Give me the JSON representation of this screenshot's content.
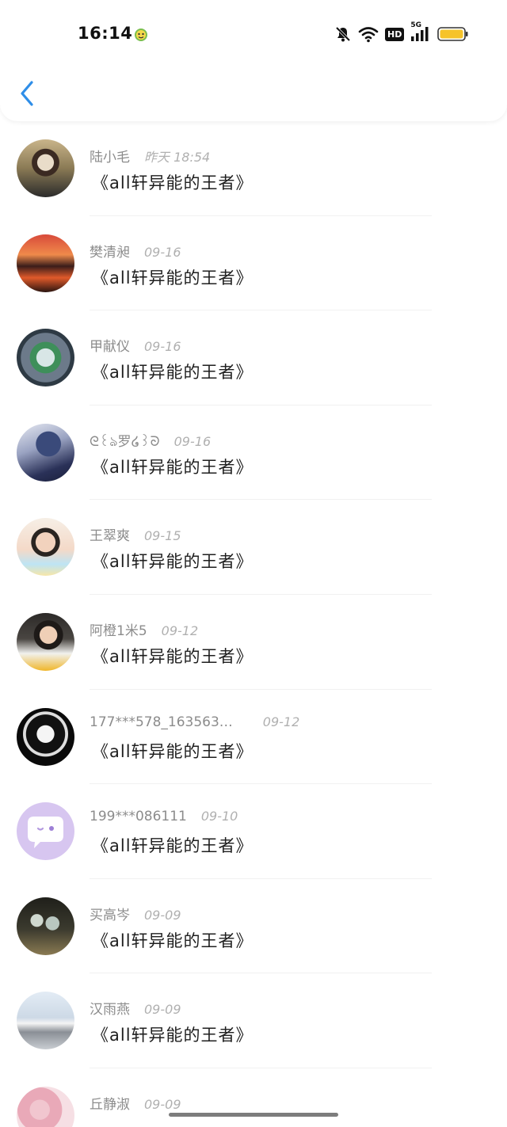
{
  "status_bar": {
    "time": "16:14",
    "network": "5G",
    "hd": "HD",
    "battery_color": "#f6c32a"
  },
  "header": {
    "back_icon": "chevron-left-icon",
    "accent": "#2f8ee8"
  },
  "items": [
    {
      "name": "陆小毛",
      "date": "昨天 18:54",
      "message": "《all轩异能的王者》",
      "avatar": "photo-girl-hands-over-face"
    },
    {
      "name": "樊清昶",
      "date": "09-16",
      "message": "《all轩异能的王者》",
      "avatar": "photo-sunset-lake"
    },
    {
      "name": "甲献仪",
      "date": "09-16",
      "message": "《all轩异能的王者》",
      "avatar": "photo-crystal-ball"
    },
    {
      "name": "ᘓ꒰ঌ罗໒꒱ᘐ",
      "date": "09-16",
      "message": "《all轩异能的王者》",
      "avatar": "photo-blue-hooded-figure"
    },
    {
      "name": "王翠爽",
      "date": "09-15",
      "message": "《all轩异能的王者》",
      "avatar": "photo-boy-peace-signs"
    },
    {
      "name": "阿橙1米5",
      "date": "09-12",
      "message": "《all轩异能的王者》",
      "avatar": "photo-boy-white-shirt"
    },
    {
      "name": "177***578_163563…",
      "date": "09-12",
      "message": "《all轩异能的王者》",
      "avatar": "anime-girl-black-white"
    },
    {
      "name": "199***086111",
      "date": "09-10",
      "message": "《all轩异能的王者》",
      "avatar": "default-chat-bubble-avatar"
    },
    {
      "name": "买高岑",
      "date": "09-09",
      "message": "《all轩异能的王者》",
      "avatar": "photo-glass-bottles"
    },
    {
      "name": "汉雨燕",
      "date": "09-09",
      "message": "《all轩异能的王者》",
      "avatar": "photo-white-car"
    },
    {
      "name": "丘静淑",
      "date": "09-09",
      "message": "",
      "avatar": "photo-pink-flowers"
    }
  ]
}
